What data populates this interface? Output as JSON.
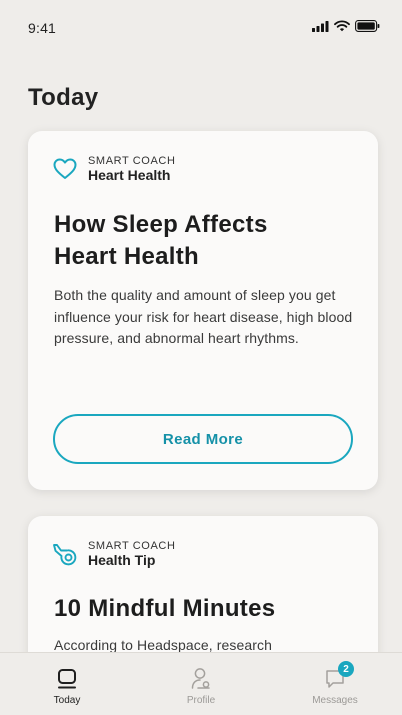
{
  "status_bar": {
    "time": "9:41"
  },
  "page": {
    "title": "Today"
  },
  "cards": [
    {
      "eyebrow": "SMART COACH",
      "category": "Heart Health",
      "icon": "heart-outline-icon",
      "title_line1": "How Sleep Affects",
      "title_line2": "Heart Health",
      "body": "Both the quality and amount of sleep you get influence your risk for heart disease, high blood pressure, and abnormal heart rhythms.",
      "button_label": "Read More"
    },
    {
      "eyebrow": "SMART COACH",
      "category": "Health Tip",
      "icon": "whistle-icon",
      "title_line1": "10 Mindful Minutes",
      "body": "According to Headspace, research"
    }
  ],
  "tab_bar": {
    "tabs": [
      {
        "label": "Today",
        "icon": "today-icon",
        "active": true
      },
      {
        "label": "Profile",
        "icon": "profile-icon",
        "active": false
      },
      {
        "label": "Messages",
        "icon": "messages-icon",
        "active": false,
        "badge": "2"
      }
    ]
  },
  "colors": {
    "accent": "#1aa7bf",
    "background": "#efedea",
    "card": "#fbfaf9"
  }
}
